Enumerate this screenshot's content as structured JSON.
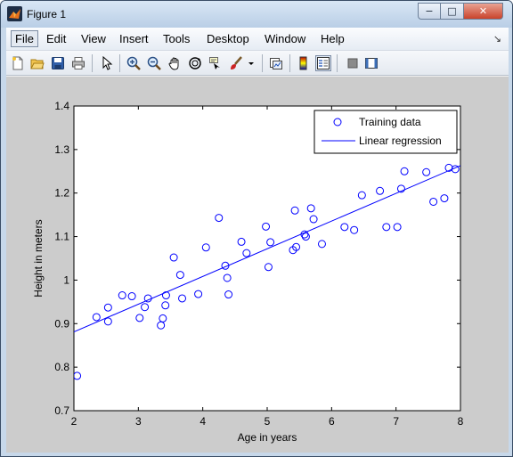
{
  "window": {
    "title": "Figure 1",
    "controls": {
      "minimize": "−",
      "maximize": "□",
      "close": "✕"
    }
  },
  "menubar": {
    "items": [
      "File",
      "Edit",
      "View",
      "Insert",
      "Tools",
      "Desktop",
      "Window",
      "Help"
    ],
    "active": "File",
    "overflow_arrow": "↘"
  },
  "toolbar": {
    "buttons": [
      "new-figure-icon",
      "open-file-icon",
      "save-icon",
      "print-icon",
      "edit-plot-arrow-icon",
      "zoom-in-icon",
      "zoom-out-icon",
      "pan-hand-icon",
      "rotate-3d-icon",
      "data-cursor-icon",
      "brush-icon",
      "brush-dropdown-icon",
      "link-plot-icon",
      "colorbar-icon",
      "legend-icon",
      "hide-plot-tools-icon",
      "show-plot-tools-icon"
    ],
    "pressed": "legend-icon"
  },
  "chart_data": {
    "type": "scatter",
    "title": "",
    "xlabel": "Age in years",
    "ylabel": "Height in meters",
    "xlim": [
      2,
      8
    ],
    "ylim": [
      0.7,
      1.4
    ],
    "xticks": [
      "2",
      "3",
      "4",
      "5",
      "6",
      "7",
      "8"
    ],
    "yticks": [
      "0.7",
      "0.8",
      "0.9",
      "1",
      "1.1",
      "1.2",
      "1.3",
      "1.4"
    ],
    "grid": false,
    "legend": {
      "placement": "top-right",
      "entries": [
        "Training data",
        "Linear regression"
      ]
    },
    "series": [
      {
        "name": "Training data",
        "type": "scatter",
        "marker": "circle",
        "color": "#0000ff",
        "x": [
          2.05,
          2.35,
          2.53,
          2.53,
          2.75,
          2.9,
          3.02,
          3.1,
          3.15,
          3.35,
          3.38,
          3.42,
          3.43,
          3.55,
          3.65,
          3.68,
          3.93,
          4.05,
          4.25,
          4.35,
          4.38,
          4.4,
          4.6,
          4.68,
          4.98,
          5.02,
          5.05,
          5.4,
          5.43,
          5.45,
          5.58,
          5.6,
          5.68,
          5.72,
          5.85,
          6.2,
          6.35,
          6.47,
          6.75,
          6.85,
          7.02,
          7.08,
          7.13,
          7.47,
          7.58,
          7.75,
          7.77,
          7.82,
          7.92
        ],
        "y": [
          0.78,
          0.915,
          0.937,
          0.905,
          0.965,
          0.963,
          0.913,
          0.938,
          0.958,
          0.896,
          0.912,
          0.942,
          0.965,
          1.052,
          1.012,
          0.958,
          0.968,
          1.075,
          1.143,
          1.033,
          1.005,
          0.967,
          1.088,
          1.062,
          1.123,
          1.03,
          1.087,
          1.069,
          1.16,
          1.076,
          1.105,
          1.1,
          1.165,
          1.14,
          1.083,
          1.122,
          1.115,
          1.195,
          1.205,
          1.122,
          1.122,
          1.21,
          1.25,
          1.248,
          1.18,
          1.188,
          1.3,
          1.258,
          1.255
        ]
      },
      {
        "name": "Linear regression",
        "type": "line",
        "color": "#0000ff",
        "x": [
          2,
          8
        ],
        "y": [
          0.881,
          1.263
        ]
      }
    ]
  }
}
